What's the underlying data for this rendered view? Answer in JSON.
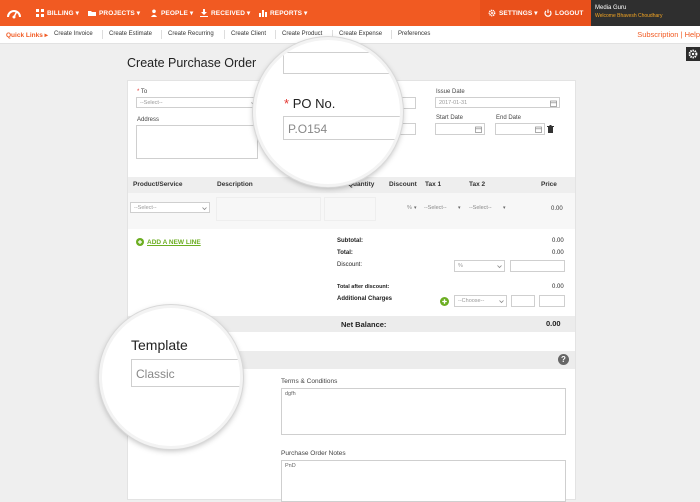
{
  "nav": {
    "items": [
      {
        "label": "BILLING ▾"
      },
      {
        "label": "PROJECTS ▾"
      },
      {
        "label": "PEOPLE ▾"
      },
      {
        "label": "RECEIVED ▾"
      },
      {
        "label": "REPORTS ▾"
      }
    ],
    "settings": "SETTINGS ▾",
    "logout": "LOGOUT",
    "user": {
      "company": "Media Guru",
      "welcome": "Welcome Bhavesh Choudhary"
    }
  },
  "quick_links": {
    "title": "Quick Links ▸",
    "links": [
      "Create Invoice",
      "Create Estimate",
      "Create Recurring",
      "Create Client",
      "Create Product",
      "Create Expense",
      "Preferences"
    ],
    "right": "Subscription | Help"
  },
  "page": {
    "title": "Create Purchase Order"
  },
  "form": {
    "to_label": "To",
    "to_placeholder": "--Select--",
    "address_label": "Address",
    "po_label": "PO No.",
    "po_value": "P.O154",
    "issue_date_label": "Issue Date",
    "issue_date_value": "2017-01-31",
    "start_date_label": "Start Date",
    "end_date_label": "End Date"
  },
  "table": {
    "headers": {
      "product": "Product/Service",
      "description": "Description",
      "quantity": "Quantity",
      "discount": "Discount",
      "tax1": "Tax 1",
      "tax2": "Tax 2",
      "price": "Price"
    },
    "row": {
      "product": "--Select--",
      "discount_unit": "%",
      "tax1": "--Select--",
      "tax2": "--Select--",
      "price": "0.00"
    }
  },
  "add_line": "ADD A NEW LINE",
  "totals": {
    "subtotal_label": "Subtotal:",
    "subtotal": "0.00",
    "total_label": "Total:",
    "total": "0.00",
    "discount_label": "Discount:",
    "discount_unit": "%",
    "after_discount_label": "Total after discount:",
    "after_discount": "0.00",
    "charges_label": "Additional Charges",
    "charges_select": "--Choose--",
    "net_label": "Net Balance:",
    "net": "0.00"
  },
  "template": {
    "label": "Template",
    "value": "Classic"
  },
  "terms": {
    "label": "Terms & Conditions",
    "value": "dgfh"
  },
  "notes": {
    "label": "Purchase Order Notes",
    "value": "PnD"
  },
  "colors": {
    "brand": "#f15a22",
    "accent_green": "#6cae22",
    "dark": "#2f2f2f"
  }
}
